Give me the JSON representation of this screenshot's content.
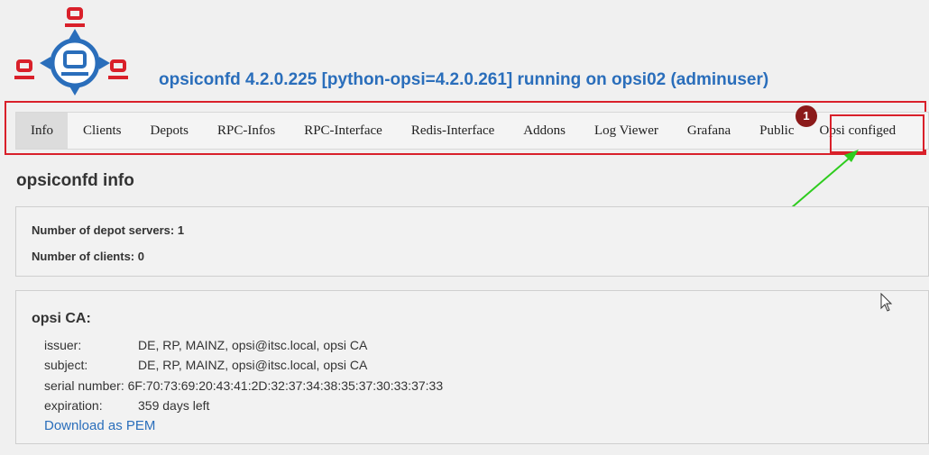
{
  "header": {
    "title": "opsiconfd 4.2.0.225 [python-opsi=4.2.0.261] running on opsi02 (adminuser)"
  },
  "nav": {
    "tabs": [
      "Info",
      "Clients",
      "Depots",
      "RPC-Infos",
      "RPC-Interface",
      "Redis-Interface",
      "Addons",
      "Log Viewer",
      "Grafana",
      "Public",
      "Opsi configed"
    ],
    "active": "Info",
    "badge": "1"
  },
  "info": {
    "title": "opsiconfd info",
    "depot_servers": "Number of depot servers: 1",
    "clients": "Number of clients: 0"
  },
  "ca": {
    "title": "opsi CA:",
    "issuer_label": "issuer:",
    "issuer": "DE, RP, MAINZ, opsi@itsc.local, opsi CA",
    "subject_label": "subject:",
    "subject": "DE, RP, MAINZ, opsi@itsc.local, opsi CA",
    "serial_label": "serial number:",
    "serial": "6F:70:73:69:20:43:41:2D:32:37:34:38:35:37:30:33:37:33",
    "expiration_label": "expiration:",
    "expiration": "359 days left",
    "download": "Download as PEM"
  },
  "colors": {
    "accent": "#2a6ebb",
    "highlight": "#d9202a",
    "badge": "#8b1a1a",
    "arrow": "#2ecc1e"
  }
}
